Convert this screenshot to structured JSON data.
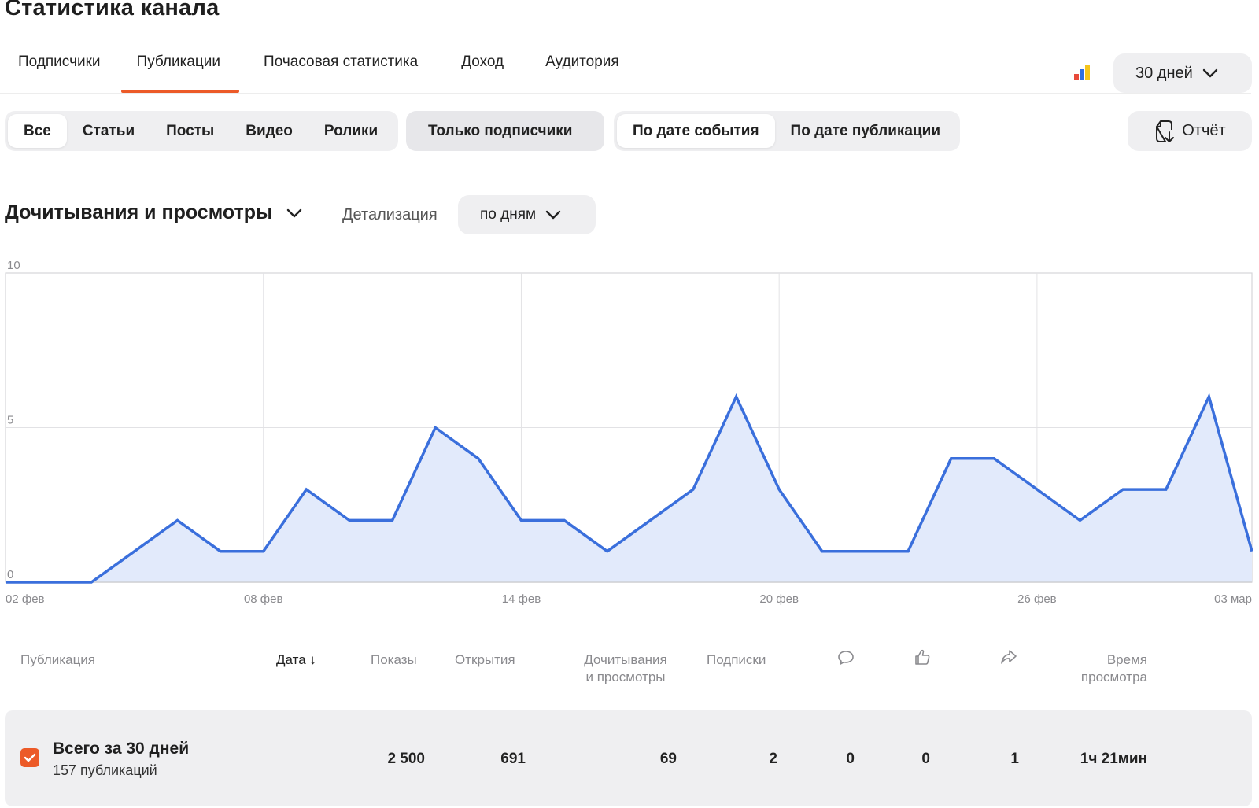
{
  "page": {
    "title": "Статистика канала"
  },
  "tabs": [
    {
      "label": "Подписчики",
      "active": false
    },
    {
      "label": "Публикации",
      "active": true
    },
    {
      "label": "Почасовая статистика",
      "active": false
    },
    {
      "label": "Доход",
      "active": false
    },
    {
      "label": "Аудитория",
      "active": false
    }
  ],
  "toolbar": {
    "stats_icon": "bar-chart-icon",
    "period_label": "30 дней",
    "report_label": "Отчёт"
  },
  "filters": {
    "content_types": [
      "Все",
      "Статьи",
      "Посты",
      "Видео",
      "Ролики"
    ],
    "content_type_selected": "Все",
    "subscribers_only": "Только подписчики",
    "date_modes": [
      "По дате события",
      "По дате публикации"
    ],
    "date_mode_selected": "По дате события"
  },
  "metric": {
    "title": "Дочитывания и просмотры",
    "detail_label": "Детализация",
    "detail_value": "по дням"
  },
  "colors": {
    "accent": "#ec5a28",
    "line": "#3a6fdc",
    "area": "#e2eafb"
  },
  "chart_data": {
    "type": "area",
    "x": [
      "02 фев",
      "03 фев",
      "04 фев",
      "05 фев",
      "06 фев",
      "07 фев",
      "08 фев",
      "09 фев",
      "10 фев",
      "11 фев",
      "12 фев",
      "13 фев",
      "14 фев",
      "15 фев",
      "16 фев",
      "17 фев",
      "18 фев",
      "19 фев",
      "20 фев",
      "21 фев",
      "22 фев",
      "23 фев",
      "24 фев",
      "25 фев",
      "26 фев",
      "27 фев",
      "28 фев",
      "01 мар",
      "02 мар",
      "03 мар"
    ],
    "series": [
      {
        "values": [
          0,
          0,
          0,
          1,
          2,
          1,
          1,
          3,
          2,
          2,
          5,
          4,
          2,
          2,
          1,
          2,
          3,
          6,
          3,
          1,
          1,
          1,
          4,
          4,
          3,
          2,
          3,
          3,
          6,
          1
        ]
      }
    ],
    "xticks": [
      "02 фев",
      "08 фев",
      "14 фев",
      "20 фев",
      "26 фев",
      "03 мар"
    ],
    "yticks": [
      0,
      5,
      10
    ],
    "ylim": [
      0,
      10
    ],
    "grid": true
  },
  "table": {
    "columns": [
      {
        "label": "Публикация"
      },
      {
        "label": "Дата ↓"
      },
      {
        "label": "Показы"
      },
      {
        "label": "Открытия"
      },
      {
        "label_line1": "Дочитывания",
        "label_line2": "и просмотры"
      },
      {
        "label": "Подписки"
      },
      {
        "icon": "comment-icon"
      },
      {
        "icon": "like-icon"
      },
      {
        "icon": "share-icon"
      },
      {
        "label_line1": "Время",
        "label_line2": "просмотра"
      }
    ],
    "total": {
      "title": "Всего за 30 дней",
      "subtitle": "157 публикаций",
      "impressions": "2 500",
      "opens": "691",
      "reads": "69",
      "subscriptions": "2",
      "comments": "0",
      "likes": "0",
      "shares": "1",
      "watch_time": "1ч 21мин"
    }
  }
}
